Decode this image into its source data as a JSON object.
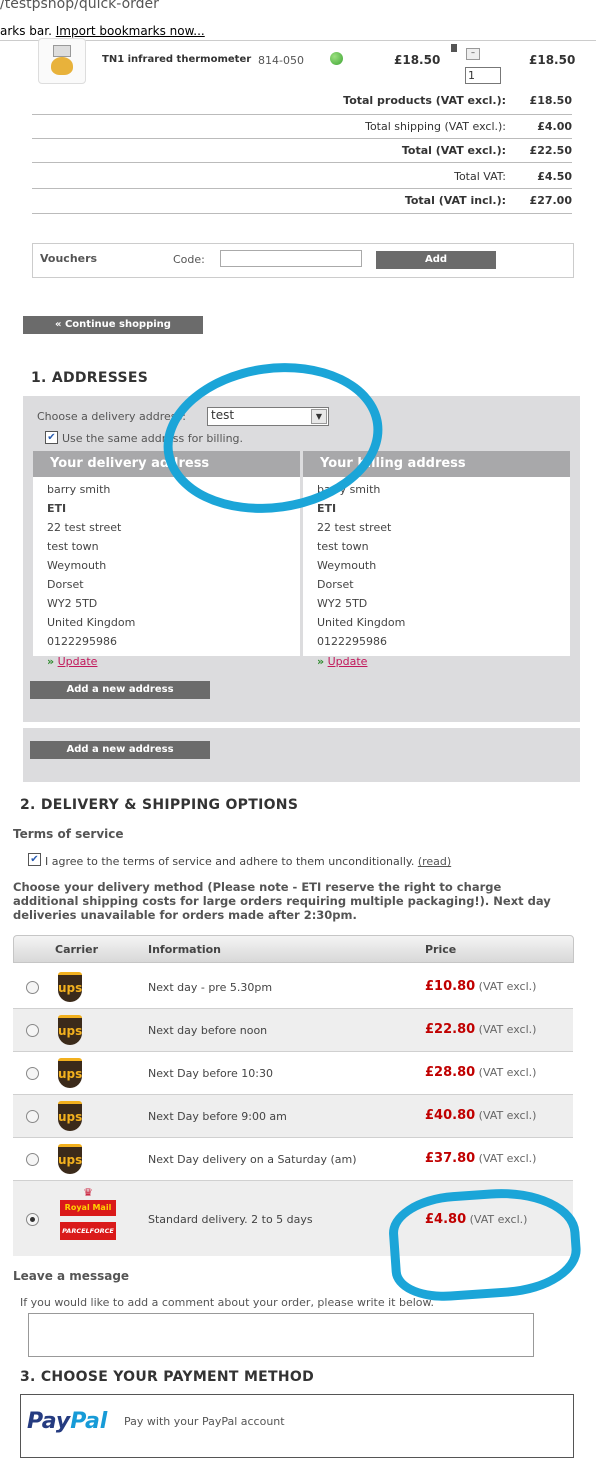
{
  "browser": {
    "url": "/testpshop/quick-order",
    "bookmarks_prefix": "arks bar.",
    "import_bookmarks": "Import bookmarks now..."
  },
  "product": {
    "name": "TN1 infrared thermometer",
    "ref": "814-050",
    "unit_price": "£18.50",
    "quantity": "1",
    "total": "£18.50",
    "availability_color": "#3fa535"
  },
  "totals": [
    {
      "label": "Total products (VAT excl.):",
      "value": "£18.50",
      "bold": true
    },
    {
      "label": "Total shipping (VAT excl.):",
      "value": "£4.00",
      "bold": false
    },
    {
      "label": "Total (VAT excl.):",
      "value": "£22.50",
      "bold": true
    },
    {
      "label": "Total VAT:",
      "value": "£4.50",
      "bold": false
    },
    {
      "label": "Total (VAT incl.):",
      "value": "£27.00",
      "bold": true
    }
  ],
  "vouchers": {
    "title": "Vouchers",
    "code_label": "Code:",
    "code_value": "",
    "add_button": "Add"
  },
  "continue_shopping": "« Continue shopping",
  "addresses": {
    "heading": "1. ADDRESSES",
    "choose_label": "Choose a delivery address:",
    "selected": "test",
    "same_billing": "Use the same address for billing.",
    "delivery_title": "Your delivery address",
    "billing_title": "Your billing address",
    "lines": [
      "barry smith",
      "ETI",
      "22 test street",
      "test town",
      "Weymouth",
      "Dorset",
      "WY2 5TD",
      "United Kingdom",
      "0122295986"
    ],
    "update": "Update",
    "add_new": "Add a new address"
  },
  "delivery": {
    "heading": "2. DELIVERY & SHIPPING OPTIONS",
    "terms_title": "Terms of service",
    "terms_text": "I agree to the terms of service and adhere to them unconditionally.",
    "terms_link": "(read)",
    "method_line1": "Choose your delivery method (Please note - ETI reserve the right to charge",
    "method_line2": "additional shipping costs for large orders requiring multiple packaging!). Next day",
    "method_line3": "deliveries unavailable for orders made after 2:30pm.",
    "col_carrier": "Carrier",
    "col_info": "Information",
    "col_price": "Price",
    "vat_note": "(VAT excl.)",
    "options": [
      {
        "carrier": "UPS",
        "info": "Next day - pre 5.30pm",
        "price": "£10.80"
      },
      {
        "carrier": "UPS",
        "info": "Next day before noon",
        "price": "£22.80"
      },
      {
        "carrier": "UPS",
        "info": "Next Day before 10:30",
        "price": "£28.80"
      },
      {
        "carrier": "UPS",
        "info": "Next Day before 9:00 am",
        "price": "£40.80"
      },
      {
        "carrier": "UPS",
        "info": "Next Day delivery on a Saturday (am)",
        "price": "£37.80"
      },
      {
        "carrier": "Royal Mail / Parcelforce",
        "info": "Standard delivery. 2 to 5 days",
        "price": "£4.80"
      }
    ],
    "logo_ups": "ups",
    "logo_royal": "Royal Mail",
    "logo_parcel": "PARCELFORCE"
  },
  "message": {
    "title": "Leave a message",
    "hint": "If you would like to add a comment about your order, please write it below.",
    "value": ""
  },
  "payment": {
    "heading": "3. CHOOSE YOUR PAYMENT METHOD",
    "paypal_logo_a": "Pay",
    "paypal_logo_b": "Pal",
    "paypal_text": "Pay with your PayPal account"
  },
  "colors": {
    "annotation": "#1ba5d8",
    "price_red": "#c00000",
    "link_pink": "#c2185b",
    "button_gray": "#6b6b6b"
  }
}
